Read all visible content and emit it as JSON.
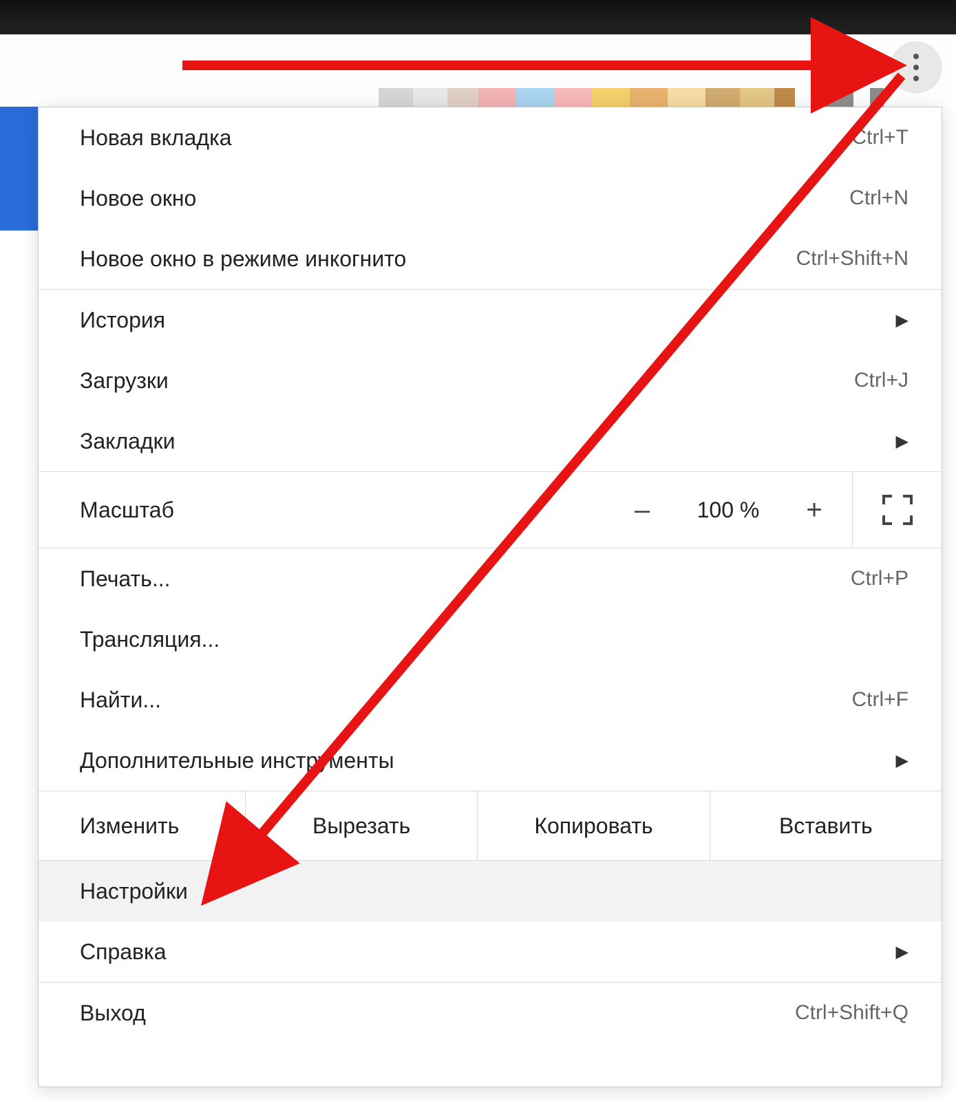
{
  "toolbar": {
    "blur_colors": [
      "#d6d6d6",
      "#e6e6e6",
      "#d3c2b8",
      "#f1b3b3",
      "#5fb2e6",
      "#f5a4a4",
      "#f2c94c",
      "#e39a5a",
      "#f6d8a0",
      "#cfa56a",
      "#e0c07a",
      "#b07c3f",
      "#d9b98a",
      "#8a8a8a",
      "#888"
    ]
  },
  "menu": {
    "new_tab": {
      "label": "Новая вкладка",
      "shortcut": "Ctrl+T"
    },
    "new_window": {
      "label": "Новое окно",
      "shortcut": "Ctrl+N"
    },
    "incognito": {
      "label": "Новое окно в режиме инкогнито",
      "shortcut": "Ctrl+Shift+N"
    },
    "history": {
      "label": "История"
    },
    "downloads": {
      "label": "Загрузки",
      "shortcut": "Ctrl+J"
    },
    "bookmarks": {
      "label": "Закладки"
    },
    "zoom": {
      "label": "Масштаб",
      "value": "100 %",
      "minus": "–",
      "plus": "+"
    },
    "print": {
      "label": "Печать...",
      "shortcut": "Ctrl+P"
    },
    "cast": {
      "label": "Трансляция..."
    },
    "find": {
      "label": "Найти...",
      "shortcut": "Ctrl+F"
    },
    "more_tools": {
      "label": "Дополнительные инструменты"
    },
    "edit": {
      "label": "Изменить",
      "cut": "Вырезать",
      "copy": "Копировать",
      "paste": "Вставить"
    },
    "settings": {
      "label": "Настройки"
    },
    "help": {
      "label": "Справка"
    },
    "exit": {
      "label": "Выход",
      "shortcut": "Ctrl+Shift+Q"
    }
  }
}
